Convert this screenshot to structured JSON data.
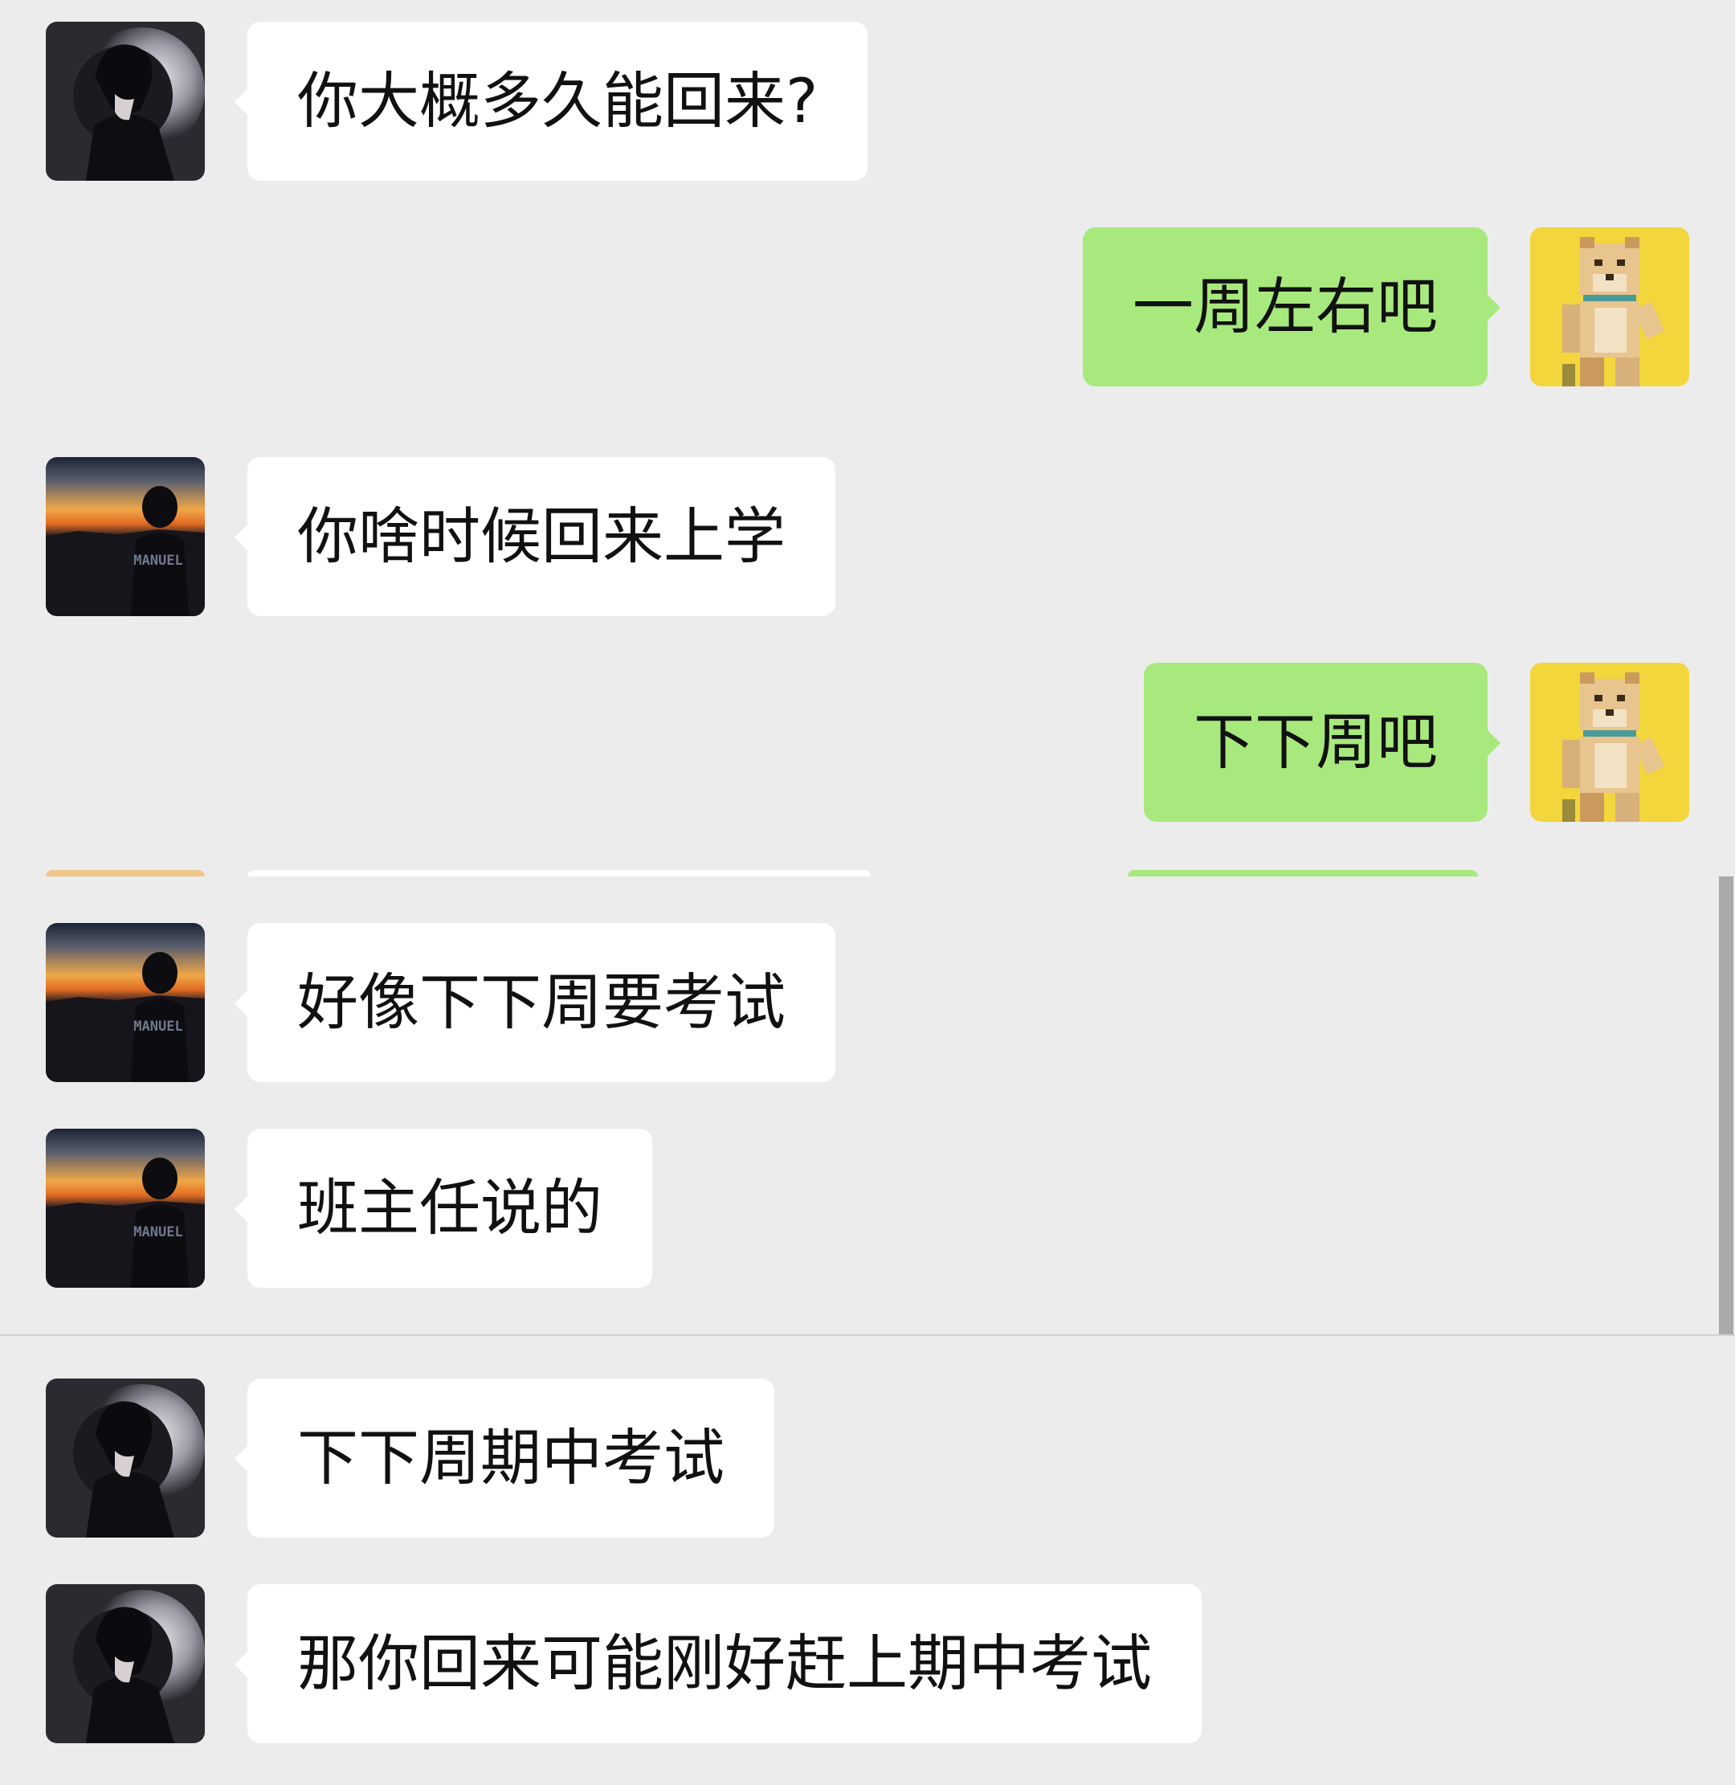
{
  "messages": [
    {
      "side": "in",
      "avatar": "anime-avatar",
      "text": "你大概多久能回来?"
    },
    {
      "side": "out",
      "avatar": "dog-avatar",
      "text": "一周左右吧"
    },
    {
      "side": "in",
      "avatar": "sunset-avatar",
      "text": "你啥时候回来上学"
    },
    {
      "side": "out",
      "avatar": "dog-avatar",
      "text": "下下周吧"
    },
    {
      "side": "in",
      "avatar": "sunset-avatar",
      "text": "好像下下周要考试"
    },
    {
      "side": "in",
      "avatar": "sunset-avatar",
      "text": "班主任说的"
    },
    {
      "side": "in",
      "avatar": "anime-avatar",
      "text": "下下周期中考试"
    },
    {
      "side": "in",
      "avatar": "anime-avatar",
      "text": "那你回来可能刚好赶上期中考试"
    }
  ],
  "avatars": {
    "sunset_label": "MANUEL"
  },
  "colors": {
    "background": "#ececec",
    "incoming_bubble": "#ffffff",
    "outgoing_bubble": "#a8e97d",
    "dog_background": "#f3d53c"
  }
}
